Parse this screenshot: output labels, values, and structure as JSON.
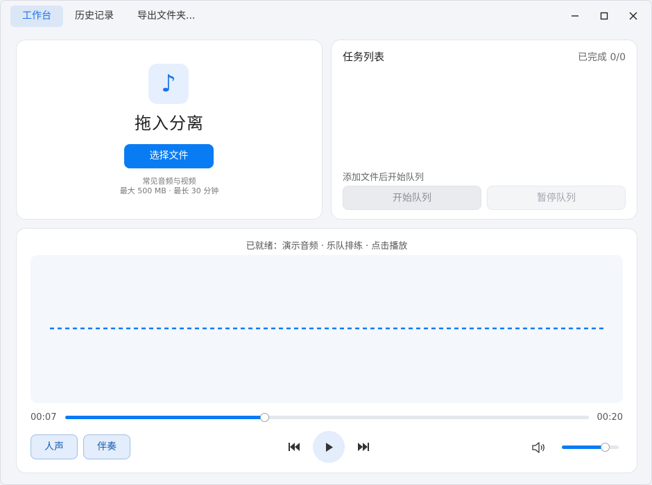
{
  "nav": {
    "tabs": [
      {
        "label": "工作台",
        "active": true
      },
      {
        "label": "历史记录",
        "active": false
      },
      {
        "label": "导出文件夹..."
      }
    ]
  },
  "window_controls": [
    "minimize-icon",
    "maximize-icon",
    "close-icon"
  ],
  "drop_zone": {
    "icon": "♪",
    "title": "拖入分离",
    "button_label": "选择文件",
    "hint_line1": "常见音频与视频",
    "hint_line2": "最大 500 MB · 最长 30 分钟"
  },
  "task_list": {
    "title": "任务列表",
    "completed": "已完成 0/0",
    "queue_hint": "添加文件后开始队列",
    "start_label": "开始队列",
    "pause_label": "暂停队列"
  },
  "player": {
    "status": "已就绪：演示音频 · 乐队排练 · 点击播放",
    "current_time": "00:07",
    "total_time": "00:20",
    "progress_fraction": 0.38,
    "volume_fraction": 0.75,
    "vocal_label": "人声",
    "accomp_label": "伴奏"
  },
  "colors": {
    "accent": "#0a7cf3",
    "active_tab_bg": "#dbe7f7",
    "track_button_bg": "#e3edfb"
  }
}
